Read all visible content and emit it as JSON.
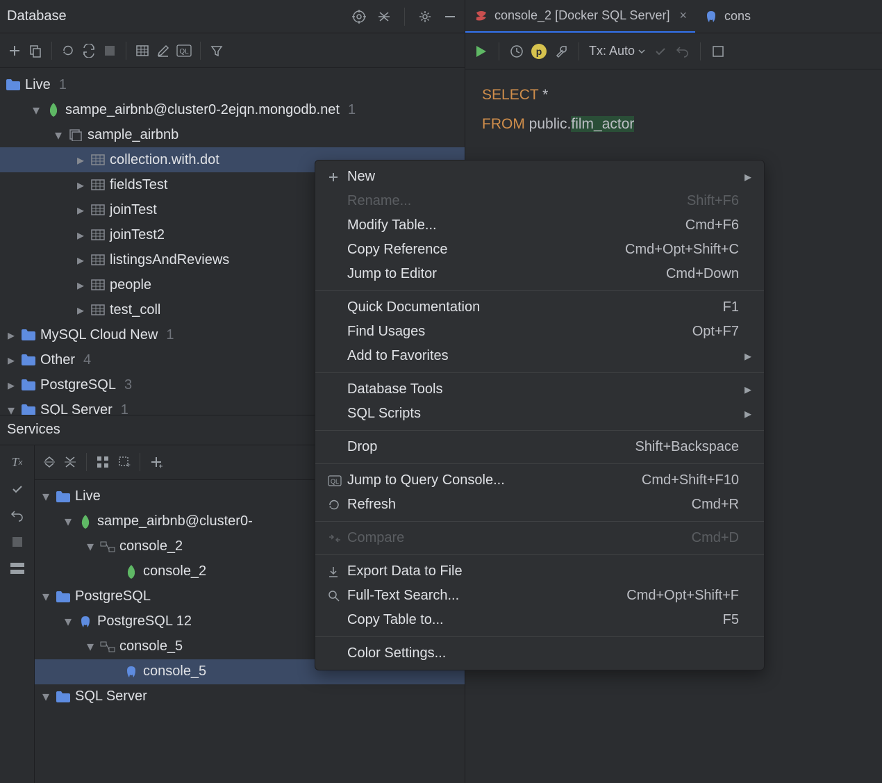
{
  "database_panel": {
    "title": "Database",
    "tree": {
      "root": {
        "label": "Live",
        "count": "1"
      },
      "connection": {
        "label": "sampe_airbnb@cluster0-2ejqn.mongodb.net",
        "count": "1"
      },
      "schema": {
        "label": "sample_airbnb"
      },
      "tables": [
        {
          "label": "collection.with.dot"
        },
        {
          "label": "fieldsTest"
        },
        {
          "label": "joinTest"
        },
        {
          "label": "joinTest2"
        },
        {
          "label": "listingsAndReviews"
        },
        {
          "label": "people"
        },
        {
          "label": "test_coll"
        }
      ],
      "folders": [
        {
          "label": "MySQL Cloud New",
          "count": "1"
        },
        {
          "label": "Other",
          "count": "4"
        },
        {
          "label": "PostgreSQL",
          "count": "3"
        },
        {
          "label": "SQL Server",
          "count": "1"
        }
      ]
    }
  },
  "services_panel": {
    "title": "Services",
    "tree": {
      "live": {
        "label": "Live"
      },
      "connection": {
        "label": "sampe_airbnb@cluster0-"
      },
      "console2_parent": {
        "label": "console_2"
      },
      "console2_child": {
        "label": "console_2"
      },
      "postgres_folder": {
        "label": "PostgreSQL"
      },
      "postgres12": {
        "label": "PostgreSQL 12"
      },
      "console5_parent": {
        "label": "console_5"
      },
      "console5_child": {
        "label": "console_5"
      },
      "sqlserver": {
        "label": "SQL Server"
      }
    }
  },
  "editor": {
    "tabs": [
      {
        "label": "console_2 [Docker SQL Server]",
        "icon": "sqlserver"
      },
      {
        "label": "cons",
        "icon": "postgres"
      }
    ],
    "toolbar": {
      "tx_label": "Tx: Auto"
    },
    "code": {
      "line1_kw": "SELECT",
      "line1_rest": " *",
      "line2_kw": "FROM",
      "line2_schema": " public.",
      "line2_table": "film_actor"
    }
  },
  "context_menu": {
    "groups": [
      [
        {
          "label": "New",
          "icon": "plus",
          "submenu": true
        },
        {
          "label": "Rename...",
          "shortcut": "Shift+F6",
          "disabled": true
        },
        {
          "label": "Modify Table...",
          "shortcut": "Cmd+F6"
        },
        {
          "label": "Copy Reference",
          "shortcut": "Cmd+Opt+Shift+C"
        },
        {
          "label": "Jump to Editor",
          "shortcut": "Cmd+Down"
        }
      ],
      [
        {
          "label": "Quick Documentation",
          "shortcut": "F1"
        },
        {
          "label": "Find Usages",
          "shortcut": "Opt+F7"
        },
        {
          "label": "Add to Favorites",
          "submenu": true
        }
      ],
      [
        {
          "label": "Database Tools",
          "submenu": true
        },
        {
          "label": "SQL Scripts",
          "submenu": true
        }
      ],
      [
        {
          "label": "Drop",
          "shortcut": "Shift+Backspace"
        }
      ],
      [
        {
          "label": "Jump to Query Console...",
          "shortcut": "Cmd+Shift+F10",
          "icon": "ql"
        },
        {
          "label": "Refresh",
          "shortcut": "Cmd+R",
          "icon": "refresh"
        }
      ],
      [
        {
          "label": "Compare",
          "shortcut": "Cmd+D",
          "icon": "compare",
          "disabled": true
        }
      ],
      [
        {
          "label": "Export Data to File",
          "icon": "export"
        },
        {
          "label": "Full-Text Search...",
          "shortcut": "Cmd+Opt+Shift+F",
          "icon": "search"
        },
        {
          "label": "Copy Table to...",
          "shortcut": "F5"
        }
      ],
      [
        {
          "label": "Color Settings..."
        }
      ]
    ]
  }
}
